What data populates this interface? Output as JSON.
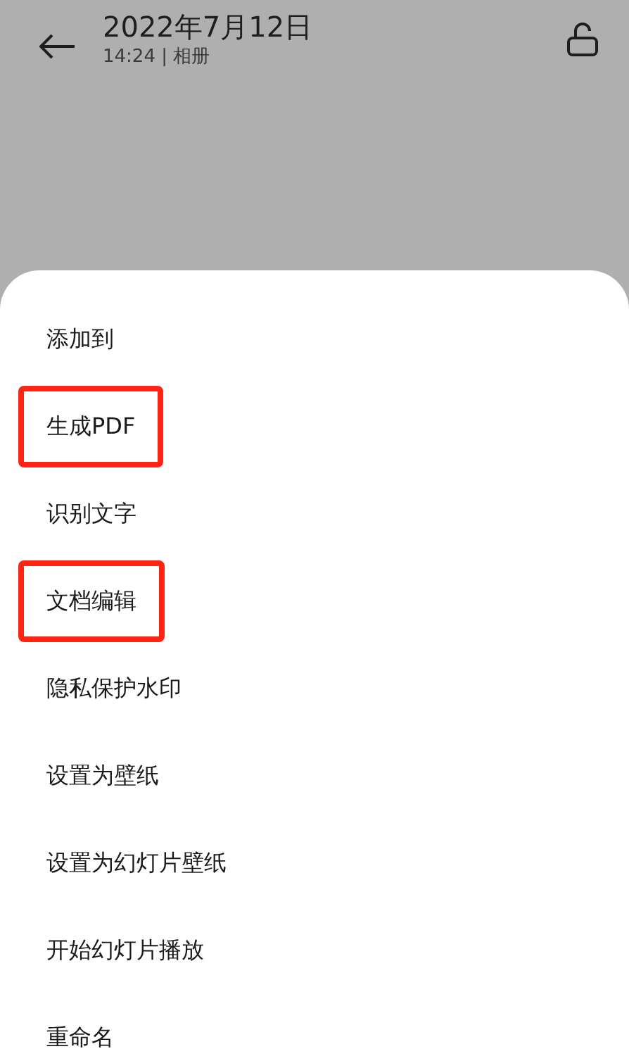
{
  "header": {
    "title": "2022年7月12日",
    "subtitle": "14:24 | 相册"
  },
  "menu": {
    "items": [
      {
        "label": "添加到",
        "highlighted": false
      },
      {
        "label": "生成PDF",
        "highlighted": true
      },
      {
        "label": "识别文字",
        "highlighted": false
      },
      {
        "label": "文档编辑",
        "highlighted": true
      },
      {
        "label": "隐私保护水印",
        "highlighted": false
      },
      {
        "label": "设置为壁纸",
        "highlighted": false
      },
      {
        "label": "设置为幻灯片壁纸",
        "highlighted": false
      },
      {
        "label": "开始幻灯片播放",
        "highlighted": false
      },
      {
        "label": "重命名",
        "highlighted": false
      }
    ]
  }
}
